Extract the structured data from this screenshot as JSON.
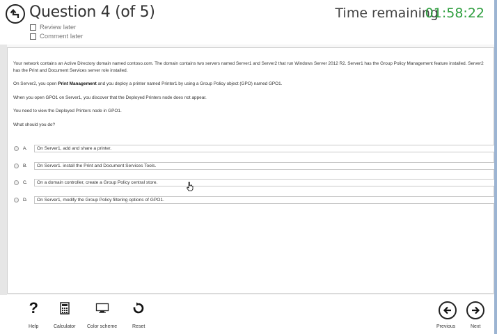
{
  "header": {
    "title": "Question 4 (of 5)",
    "review_later": "Review later",
    "comment_later": "Comment later",
    "time_label": "Time remaining",
    "time_value": "01:58:22"
  },
  "question": {
    "p1": "Your network contains an Active Directory domain named contoso.com. The domain contains two servers named Server1 and Server2 that run Windows Server 2012 R2. Server1 has the Group Policy Management feature installed. Server2 has the Print and Document Services server role installed.",
    "p2_before": "On Server2, you open ",
    "p2_bold": "Print Management",
    "p2_after": " and you deploy a printer named Printer1 by using a Group Policy object (GPO) named GPO1.",
    "p3": "When you open GPO1 on Server1, you discover that the Deployed Printers node does not appear.",
    "p4": "You need to view the Deployed Printers node in GPO1.",
    "p5": "What should you do?"
  },
  "options": [
    {
      "letter": "A.",
      "text": "On Server1, add and share a printer."
    },
    {
      "letter": "B.",
      "text": "On Server1. install the Print and Document Services Tools."
    },
    {
      "letter": "C.",
      "text": "On a domain controller, create a Group Policy central store."
    },
    {
      "letter": "D.",
      "text": "On Server1, modify the Group Policy filtering options of GPO1."
    }
  ],
  "footer": {
    "help": "Help",
    "calculator": "Calculator",
    "color_scheme": "Color scheme",
    "reset": "Reset",
    "previous": "Previous",
    "next": "Next"
  },
  "colors": {
    "timer": "#2e9e3e",
    "accent_strip": "#9cb4d2"
  }
}
